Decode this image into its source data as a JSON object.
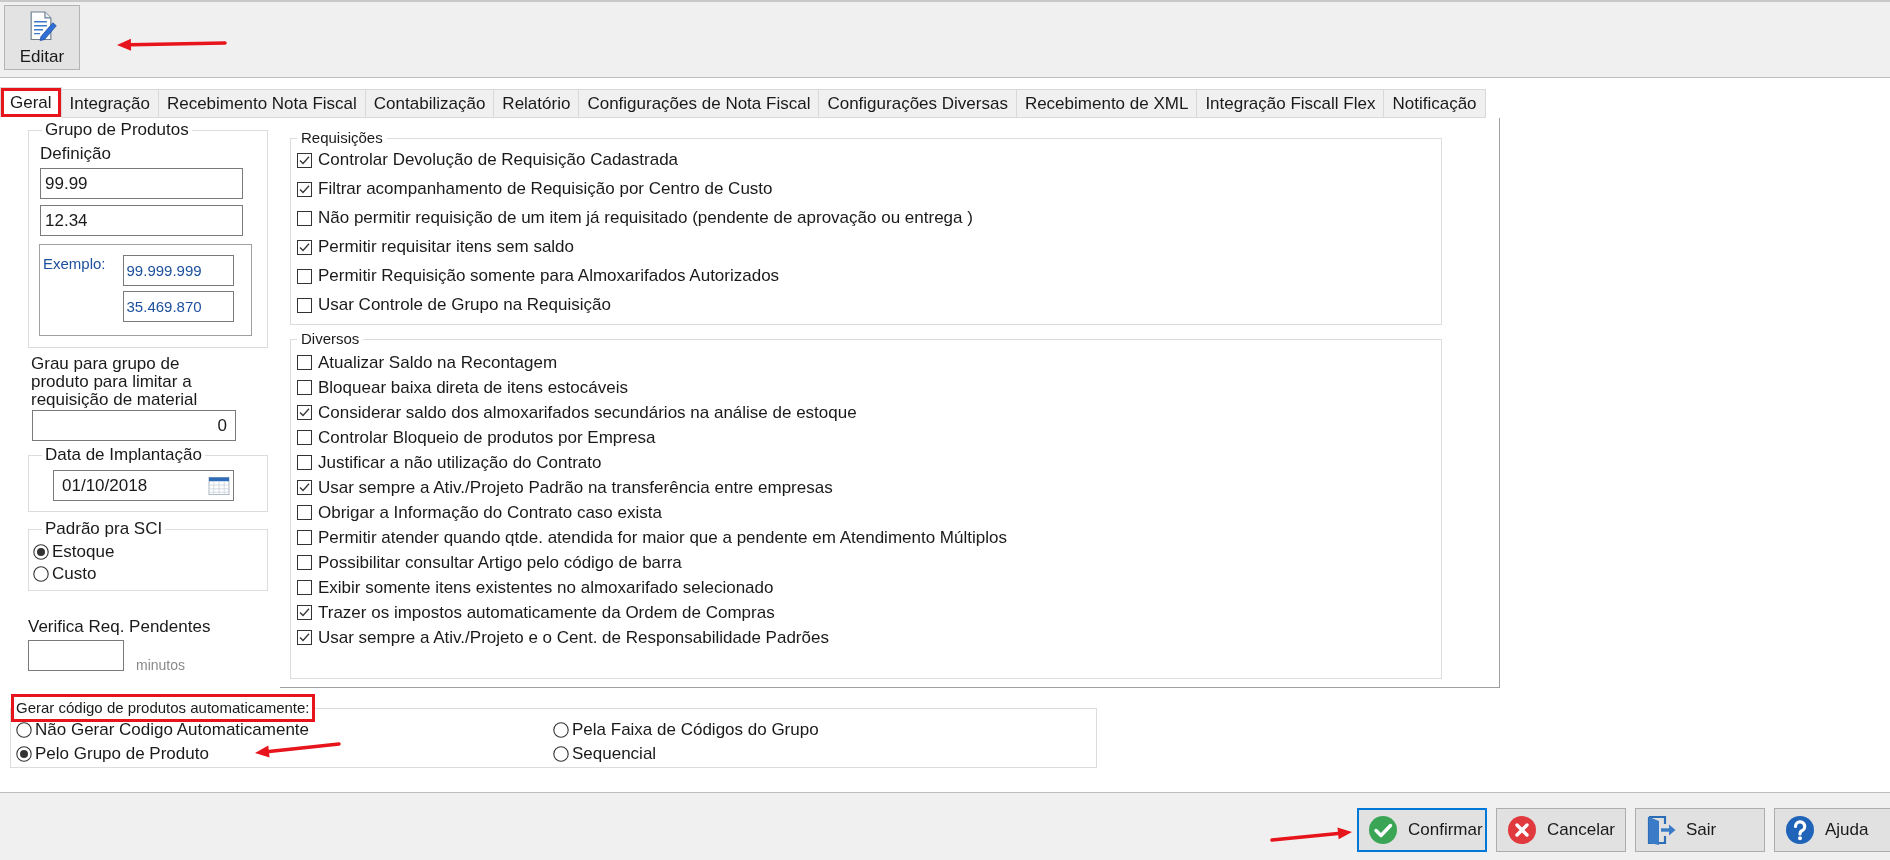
{
  "toolbar": {
    "buttons": [
      {
        "label": "Editar",
        "arrow": true
      }
    ]
  },
  "tabs": [
    {
      "label": "Geral",
      "selected": true,
      "highlighted": true
    },
    {
      "label": "Integração",
      "selected": false,
      "highlighted": false
    },
    {
      "label": "Recebimento Nota Fiscal",
      "selected": false,
      "highlighted": false
    },
    {
      "label": "Contabilização",
      "selected": false,
      "highlighted": false
    },
    {
      "label": "Relatório",
      "selected": false,
      "highlighted": false
    },
    {
      "label": "Configurações de Nota Fiscal",
      "selected": false,
      "highlighted": false
    },
    {
      "label": "Configurações Diversas",
      "selected": false,
      "highlighted": false
    },
    {
      "label": "Recebimento de XML",
      "selected": false,
      "highlighted": false
    },
    {
      "label": "Integração Fiscall Flex",
      "selected": false,
      "highlighted": false
    },
    {
      "label": "Notificação",
      "selected": false,
      "highlighted": false
    }
  ],
  "grupo_de_produtos": {
    "title": "Grupo de Produtos",
    "definicao_label": "Definição",
    "definicao_values": [
      "99.99",
      "12.34"
    ],
    "example_label": "Exemplo:",
    "example_values": [
      "99.999.999",
      "35.469.870"
    ]
  },
  "grau": {
    "label": "Grau para grupo de produto para limitar a requisição de material",
    "value": "0"
  },
  "data_de_implantacao": {
    "title": "Data de Implantação",
    "value": "01/10/2018"
  },
  "padrao_pra_sci": {
    "title": "Padrão pra SCI",
    "options": [
      {
        "label": "Estoque",
        "selected": true
      },
      {
        "label": "Custo",
        "selected": false
      }
    ]
  },
  "verifica_req_pendentes": {
    "label": "Verifica Req. Pendentes",
    "unit": "minutos"
  },
  "requisicoes": {
    "title": "Requisições",
    "items": [
      {
        "label": "Controlar Devolução de Requisição Cadastrada",
        "checked": true
      },
      {
        "label": "Filtrar acompanhamento de Requisição por Centro de Custo",
        "checked": true
      },
      {
        "label": "Não permitir requisição de um item já requisitado (pendente de aprovação ou entrega )",
        "checked": false
      },
      {
        "label": "Permitir requisitar itens sem saldo",
        "checked": true
      },
      {
        "label": "Permitir Requisição somente para Almoxarifados Autorizados",
        "checked": false
      },
      {
        "label": "Usar Controle de Grupo na Requisição",
        "checked": false
      }
    ]
  },
  "diversos": {
    "title": "Diversos",
    "items": [
      {
        "label": "Atualizar Saldo na Recontagem",
        "checked": false
      },
      {
        "label": "Bloquear baixa direta de itens estocáveis",
        "checked": false
      },
      {
        "label": "Considerar saldo dos almoxarifados secundários na análise de estoque",
        "checked": true
      },
      {
        "label": "Controlar Bloqueio de produtos por Empresa",
        "checked": false
      },
      {
        "label": "Justificar a não utilização do Contrato",
        "checked": false
      },
      {
        "label": "Usar sempre a Ativ./Projeto Padrão na transferência entre empresas",
        "checked": true
      },
      {
        "label": "Obrigar a Informação do Contrato caso exista",
        "checked": false
      },
      {
        "label": "Permitir atender quando qtde. atendida for maior que a pendente em Atendimento Múltiplos",
        "checked": false
      },
      {
        "label": "Possibilitar consultar Artigo pelo código de barra",
        "checked": false
      },
      {
        "label": "Exibir somente itens existentes no almoxarifado selecionado",
        "checked": false
      },
      {
        "label": "Trazer os impostos automaticamente da Ordem de Compras",
        "checked": true
      },
      {
        "label": "Usar sempre a Ativ./Projeto e o Cent. de Responsabilidade Padrões",
        "checked": true
      }
    ]
  },
  "gerar_codigo": {
    "title": "Gerar código de produtos automaticamente:",
    "highlighted": true,
    "options": [
      {
        "label": "Não Gerar Codigo Automaticamente",
        "selected": false,
        "arrow": false
      },
      {
        "label": "Pelo Grupo de Produto",
        "selected": true,
        "arrow": true
      },
      {
        "label": "Pela Faixa de Códigos do Grupo",
        "selected": false,
        "arrow": false
      },
      {
        "label": "Sequencial",
        "selected": false,
        "arrow": false
      }
    ]
  },
  "footer_buttons": [
    {
      "kind": "confirm",
      "label": "Confirmar",
      "focused": true,
      "arrow": true
    },
    {
      "kind": "cancel",
      "label": "Cancelar",
      "focused": false,
      "arrow": false
    },
    {
      "kind": "exit",
      "label": "Sair",
      "focused": false,
      "arrow": false
    },
    {
      "kind": "help",
      "label": "Ajuda",
      "focused": false,
      "arrow": false
    }
  ]
}
